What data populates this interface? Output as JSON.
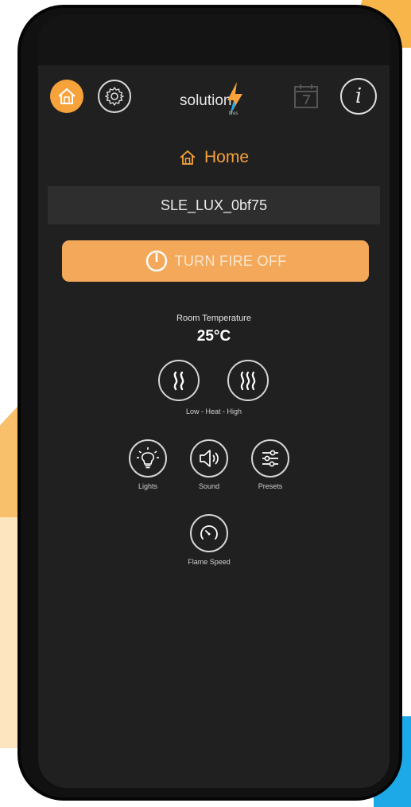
{
  "app": {
    "logo_text": "solution",
    "logo_subtext": "fires"
  },
  "header": {
    "title": "Home",
    "info_glyph": "i"
  },
  "device": {
    "name": "SLE_LUX_0bf75"
  },
  "power": {
    "label": "TURN FIRE OFF"
  },
  "temperature": {
    "label": "Room Temperature",
    "value": "25°C"
  },
  "heat": {
    "caption": "Low - Heat - High"
  },
  "controls": {
    "lights_label": "Lights",
    "sound_label": "Sound",
    "presets_label": "Presets",
    "flame_speed_label": "Flame Speed"
  },
  "icons": {
    "home": "home-icon",
    "settings": "gear-icon",
    "calendar": "calendar-icon",
    "info": "info-icon",
    "power": "power-icon",
    "heat_low": "heat-low-icon",
    "heat_high": "heat-high-icon",
    "lights": "lightbulb-icon",
    "sound": "speaker-icon",
    "presets": "sliders-icon",
    "flame_speed": "speedometer-icon"
  },
  "colors": {
    "accent": "#f7a23b",
    "power_button": "#f4a85a",
    "screen_background": "#202020",
    "logo_bolt": "#f7a23b",
    "logo_bolt_blue": "#1da9e8"
  }
}
